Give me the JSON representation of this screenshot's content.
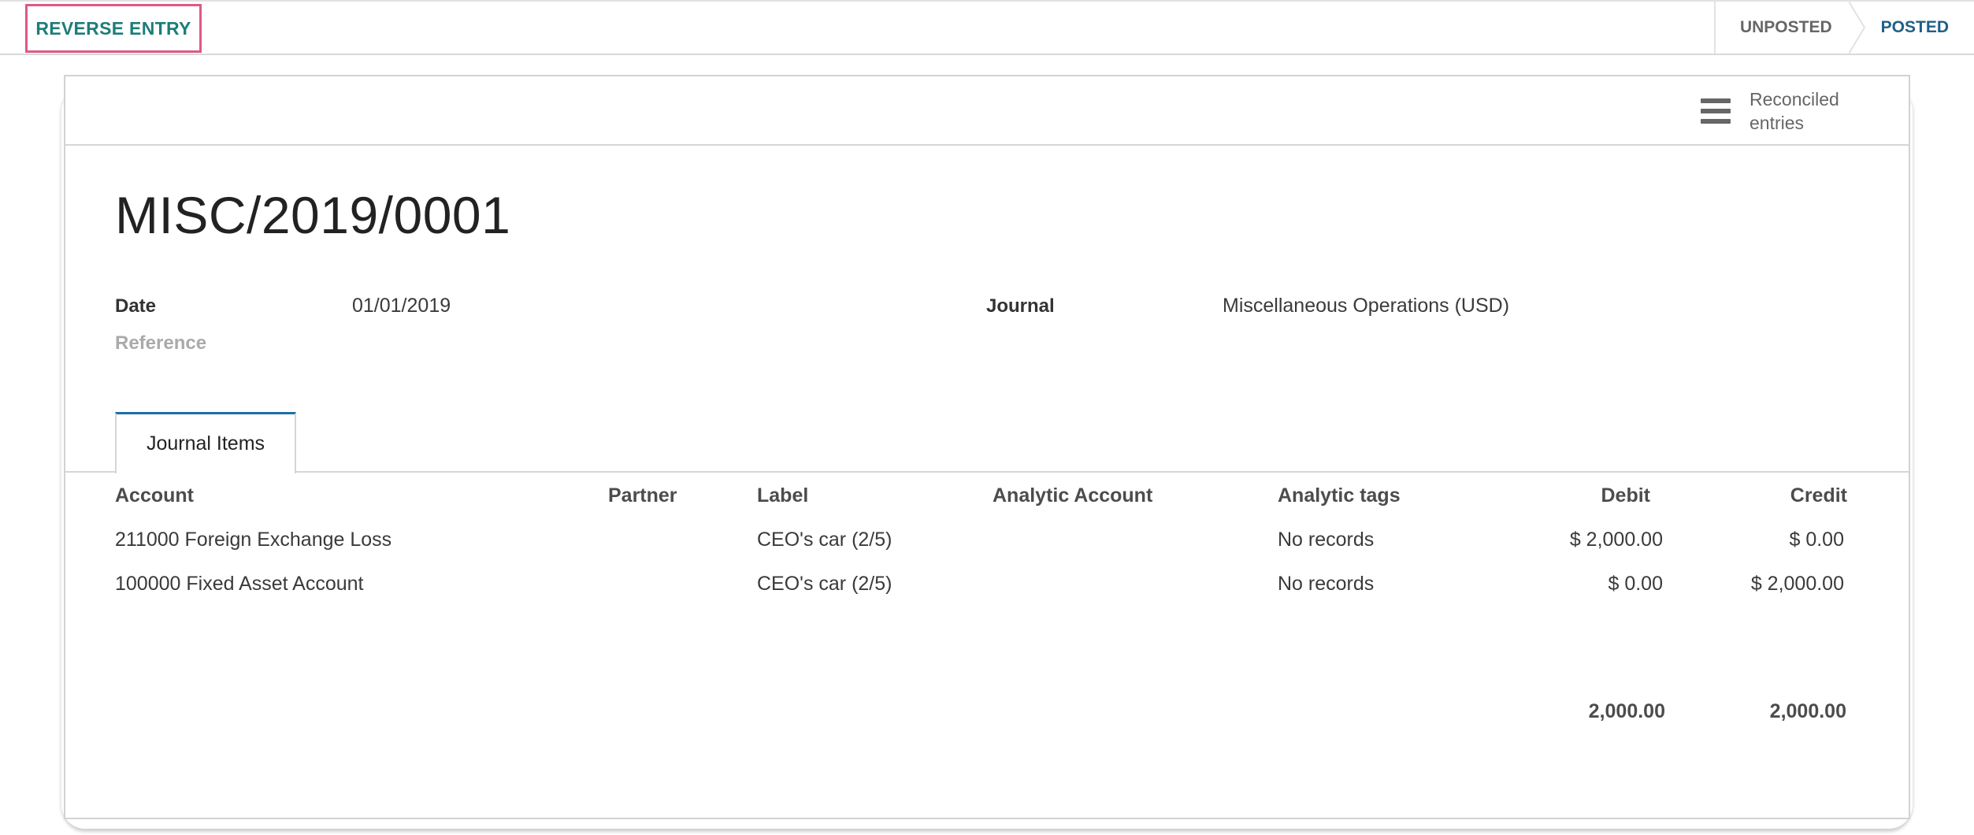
{
  "statusbar": {
    "reverse_button": "REVERSE ENTRY",
    "stages": [
      "UNPOSTED",
      "POSTED"
    ]
  },
  "smart_button": {
    "icon": "bars-icon",
    "label": "Reconciled entries"
  },
  "entry": {
    "name": "MISC/2019/0001",
    "date_label": "Date",
    "date_value": "01/01/2019",
    "reference_label": "Reference",
    "journal_label": "Journal",
    "journal_value": "Miscellaneous Operations (USD)"
  },
  "tabs": {
    "journal_items": "Journal Items"
  },
  "table": {
    "headers": {
      "account": "Account",
      "partner": "Partner",
      "label": "Label",
      "analytic_account": "Analytic Account",
      "analytic_tags": "Analytic tags",
      "debit": "Debit",
      "credit": "Credit"
    },
    "rows": [
      {
        "account": "211000 Foreign Exchange Loss",
        "partner": "",
        "label": "CEO's car (2/5)",
        "analytic_account": "",
        "analytic_tags": "No records",
        "debit": "$ 2,000.00",
        "credit": "$ 0.00"
      },
      {
        "account": "100000 Fixed Asset Account",
        "partner": "",
        "label": "CEO's car (2/5)",
        "analytic_account": "",
        "analytic_tags": "No records",
        "debit": "$ 0.00",
        "credit": "$ 2,000.00"
      }
    ],
    "totals": {
      "debit": "2,000.00",
      "credit": "2,000.00"
    }
  },
  "colors": {
    "highlight_border": "#dd5a84",
    "reverse_text": "#1d7d7a",
    "active_stage": "#1f5f88",
    "tab_accent": "#1f6fa8"
  }
}
